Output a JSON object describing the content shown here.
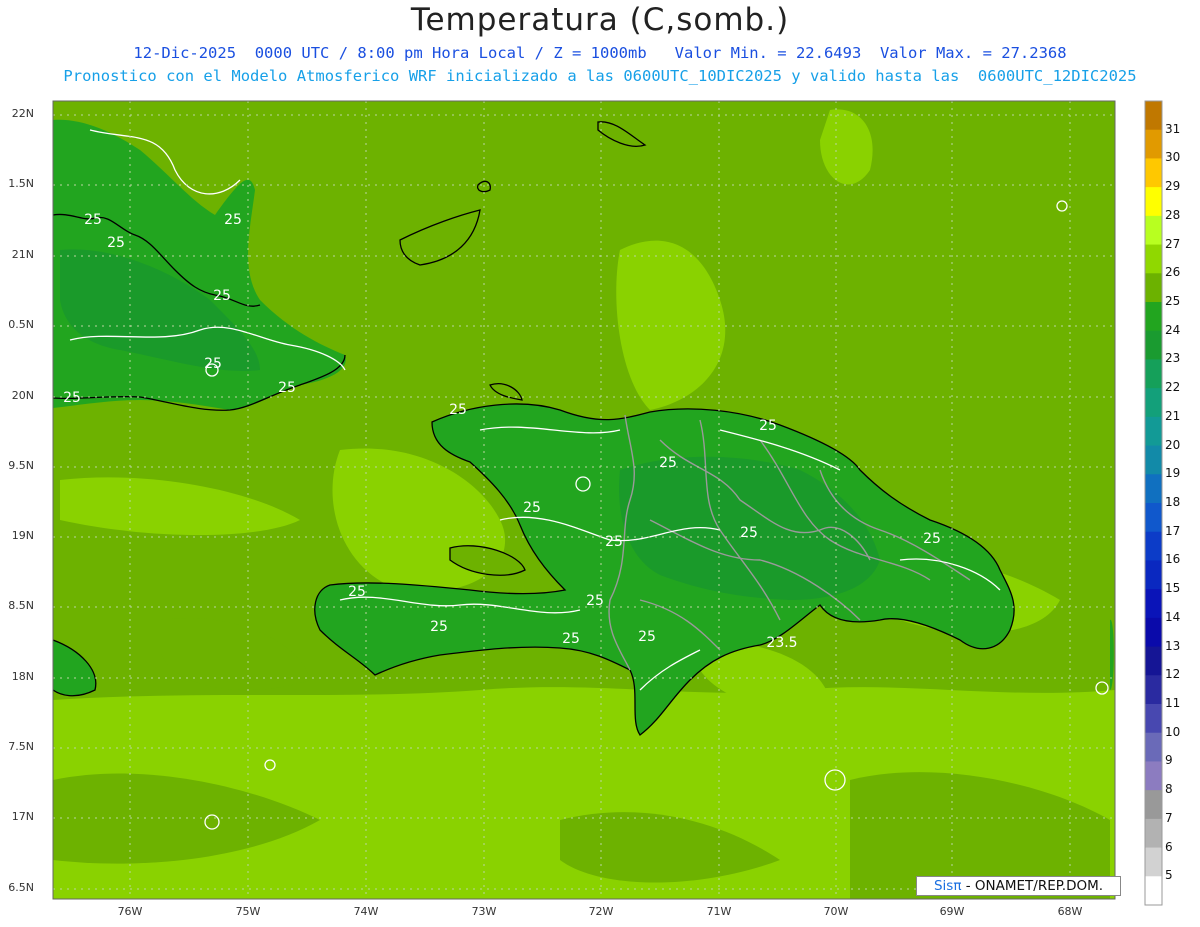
{
  "header": {
    "title": "Temperatura (C,somb.)",
    "subtitle_line1": "12-Dic-2025  0000 UTC / 8:00 pm Hora Local / Z = 1000mb   Valor Min. = 22.6493  Valor Max. = 27.2368",
    "subtitle_line2": "Pronostico con el Modelo Atmosferico WRF inicializado a las 0600UTC_10DIC2025 y valido hasta las  0600UTC_12DIC2025"
  },
  "map": {
    "lat_labels": [
      "22N",
      "1.5N",
      "21N",
      "0.5N",
      "20N",
      "9.5N",
      "19N",
      "8.5N",
      "18N",
      "7.5N",
      "17N",
      "6.5N"
    ],
    "lon_labels": [
      "76W",
      "75W",
      "74W",
      "73W",
      "72W",
      "71W",
      "70W",
      "69W",
      "68W"
    ],
    "contour_labels": [
      "25",
      "25",
      "25",
      "25",
      "25",
      "25",
      "25",
      "25",
      "25",
      "25",
      "25",
      "25",
      "25",
      "25",
      "25",
      "25",
      "25",
      "25",
      "25",
      "23.5"
    ],
    "colors": {
      "sea": "#6db200",
      "sea_light": "#8ad200",
      "land": "#22a51f",
      "land_dark": "#1a9a2a",
      "coast": "#000000",
      "borders": "#9a9a9a",
      "contour": "#ffffff",
      "grid": "#b9d6a0"
    }
  },
  "colorbar": {
    "labels": [
      "31",
      "30",
      "29",
      "28",
      "27",
      "26",
      "25",
      "24",
      "23",
      "22",
      "21",
      "20",
      "19",
      "18",
      "17",
      "16",
      "15",
      "14",
      "13",
      "12",
      "11",
      "10",
      "9",
      "8",
      "7",
      "6",
      "5"
    ],
    "colors": [
      "#c07800",
      "#e19a00",
      "#ffc800",
      "#ffff00",
      "#b8ff20",
      "#90d800",
      "#6cb200",
      "#22a51f",
      "#1a9b30",
      "#15a05a",
      "#13a07a",
      "#129a96",
      "#128aa8",
      "#1070c0",
      "#1058cc",
      "#0c3cc8",
      "#0a28c0",
      "#0a14b8",
      "#0a0aaa",
      "#151595",
      "#2a2aa0",
      "#4848b0",
      "#6a6ab8",
      "#8c7cc0",
      "#999999",
      "#b2b2b2",
      "#d2d2d2",
      "#ffffff"
    ]
  },
  "credit": {
    "brand": "Sis",
    "brand_symbol": "π",
    "text": " - ONAMET/REP.DOM."
  }
}
